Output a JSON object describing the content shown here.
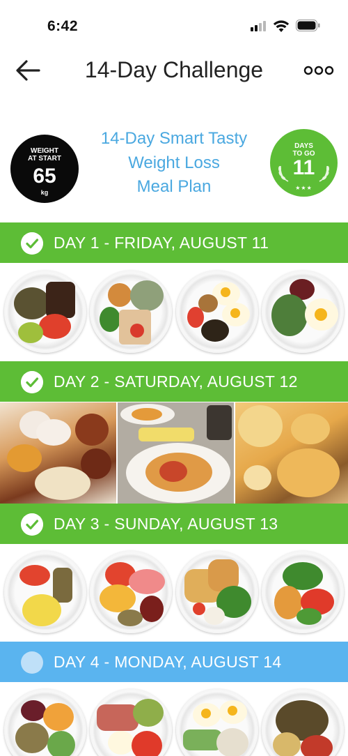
{
  "status_bar": {
    "time": "6:42"
  },
  "header": {
    "title": "14-Day Challenge"
  },
  "summary": {
    "weight_label_line1": "WEIGHT",
    "weight_label_line2": "AT START",
    "weight_value": "65",
    "weight_unit": "kg",
    "plan_title_line1": "14-Day Smart Tasty",
    "plan_title_line2": "Weight Loss",
    "plan_title_line3": "Meal Plan",
    "days_label_line1": "DAYS",
    "days_label_line2": "TO GO",
    "days_value": "11",
    "stars": "★★★"
  },
  "days": [
    {
      "label": "DAY 1 - FRIDAY, AUGUST 11",
      "status": "done"
    },
    {
      "label": "DAY 2 - SATURDAY, AUGUST 12",
      "status": "done"
    },
    {
      "label": "DAY 3 - SUNDAY, AUGUST 13",
      "status": "done"
    },
    {
      "label": "DAY 4 - MONDAY, AUGUST 14",
      "status": "upcoming"
    }
  ],
  "colors": {
    "done_green": "#5dbd36",
    "upcoming_blue": "#5ab4ef",
    "plan_title_blue": "#4aa8e0",
    "weight_badge_black": "#0a0a0a"
  },
  "icons": {
    "back": "arrow-left-icon",
    "more": "ellipsis-icon",
    "done": "checkmark-circle-icon",
    "upcoming": "empty-circle-icon"
  }
}
